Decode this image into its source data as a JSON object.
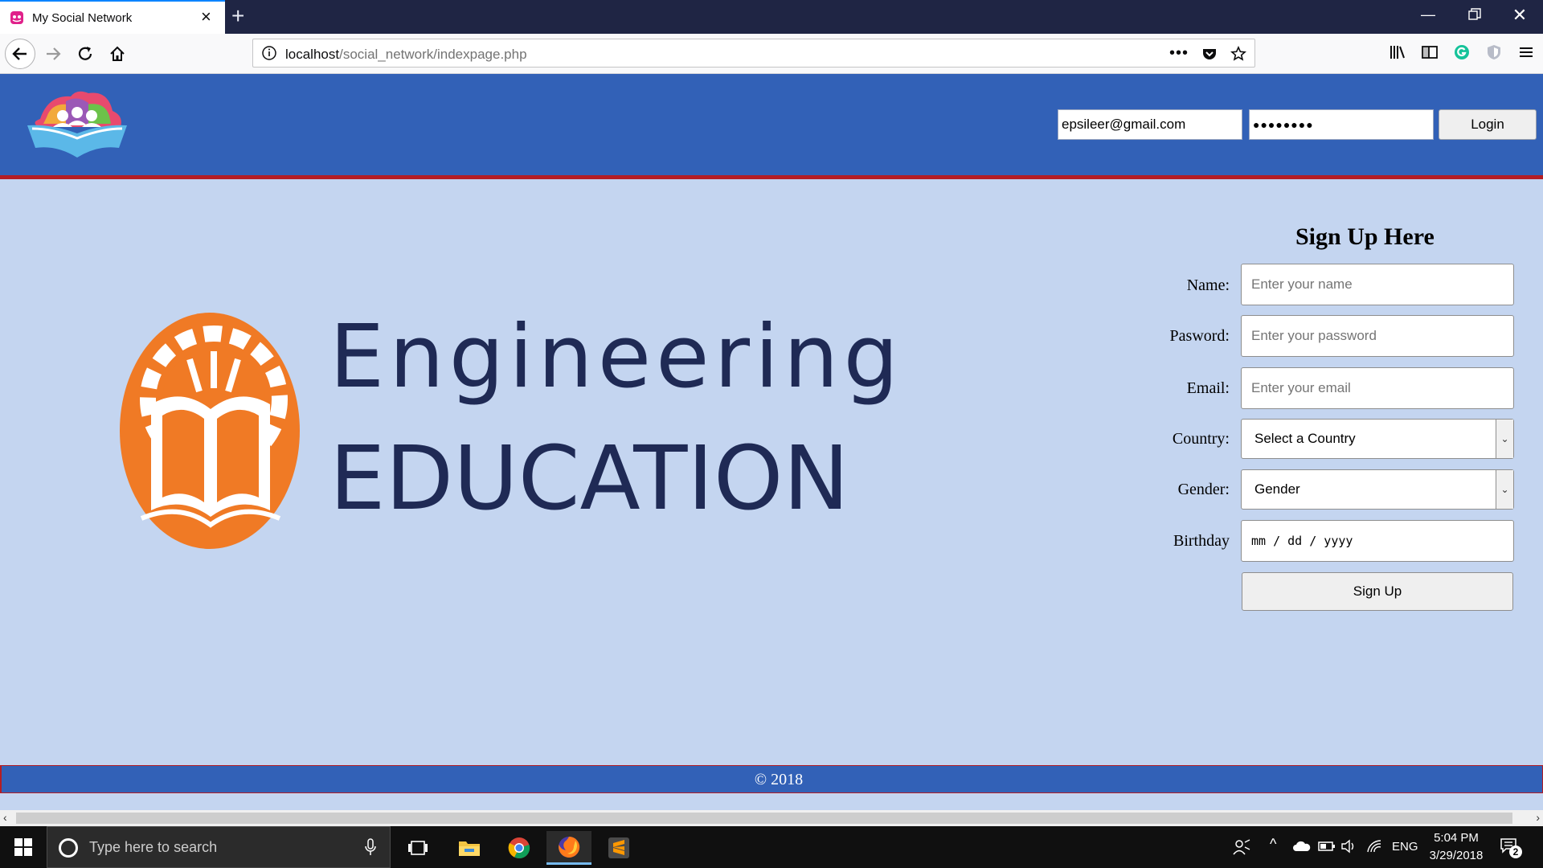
{
  "browser": {
    "tab_title": "My Social Network",
    "url_host": "localhost",
    "url_path": "/social_network/indexpage.php"
  },
  "header": {
    "login_email_value": "epsileer@gmail.com",
    "login_password_value": "●●●●●●●●",
    "login_button": "Login"
  },
  "brand": {
    "word1": "Engineering",
    "word2": "EDUCATION"
  },
  "signup": {
    "title": "Sign Up Here",
    "name_label": "Name:",
    "name_placeholder": "Enter your name",
    "password_label": "Pasword:",
    "password_placeholder": "Enter your password",
    "email_label": "Email:",
    "email_placeholder": "Enter your email",
    "country_label": "Country:",
    "country_selected": "Select a Country",
    "gender_label": "Gender:",
    "gender_selected": "Gender",
    "birthday_label": "Birthday",
    "birthday_placeholder": "mm / dd / yyyy",
    "submit": "Sign Up"
  },
  "footer": {
    "text": "© 2018"
  },
  "taskbar": {
    "search_placeholder": "Type here to search",
    "language": "ENG",
    "time": "5:04 PM",
    "date": "3/29/2018",
    "notification_count": "2"
  },
  "colors": {
    "header_blue": "#3261b7",
    "accent_red": "#b41d24",
    "page_bg": "#c4d5f0",
    "brand_orange": "#f07a25",
    "brand_navy": "#1f2a55"
  }
}
